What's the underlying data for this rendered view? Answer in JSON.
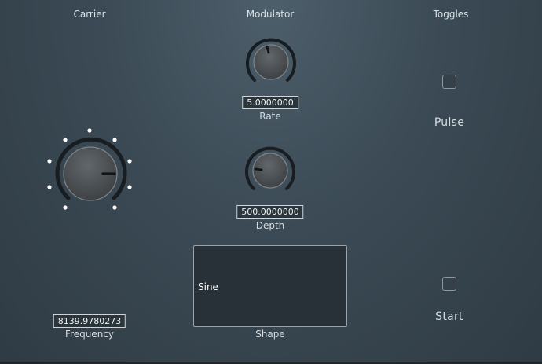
{
  "sections": {
    "carrier": "Carrier",
    "modulator": "Modulator",
    "toggles": "Toggles"
  },
  "carrier": {
    "frequency_value": "8139.9780273",
    "frequency_label": "Frequency"
  },
  "modulator": {
    "rate_value": "5.0000000",
    "rate_label": "Rate",
    "depth_value": "500.0000000",
    "depth_label": "Depth"
  },
  "shape": {
    "value": "Sine",
    "label": "Shape"
  },
  "toggles": {
    "pulse_label": "Pulse",
    "pulse_checked": false,
    "start_label": "Start",
    "start_checked": false
  },
  "colors": {
    "background": "#3b4a55",
    "knob_arc": "#1b2227",
    "knob_face": "#4a4f53",
    "indicator": "#15191c"
  }
}
